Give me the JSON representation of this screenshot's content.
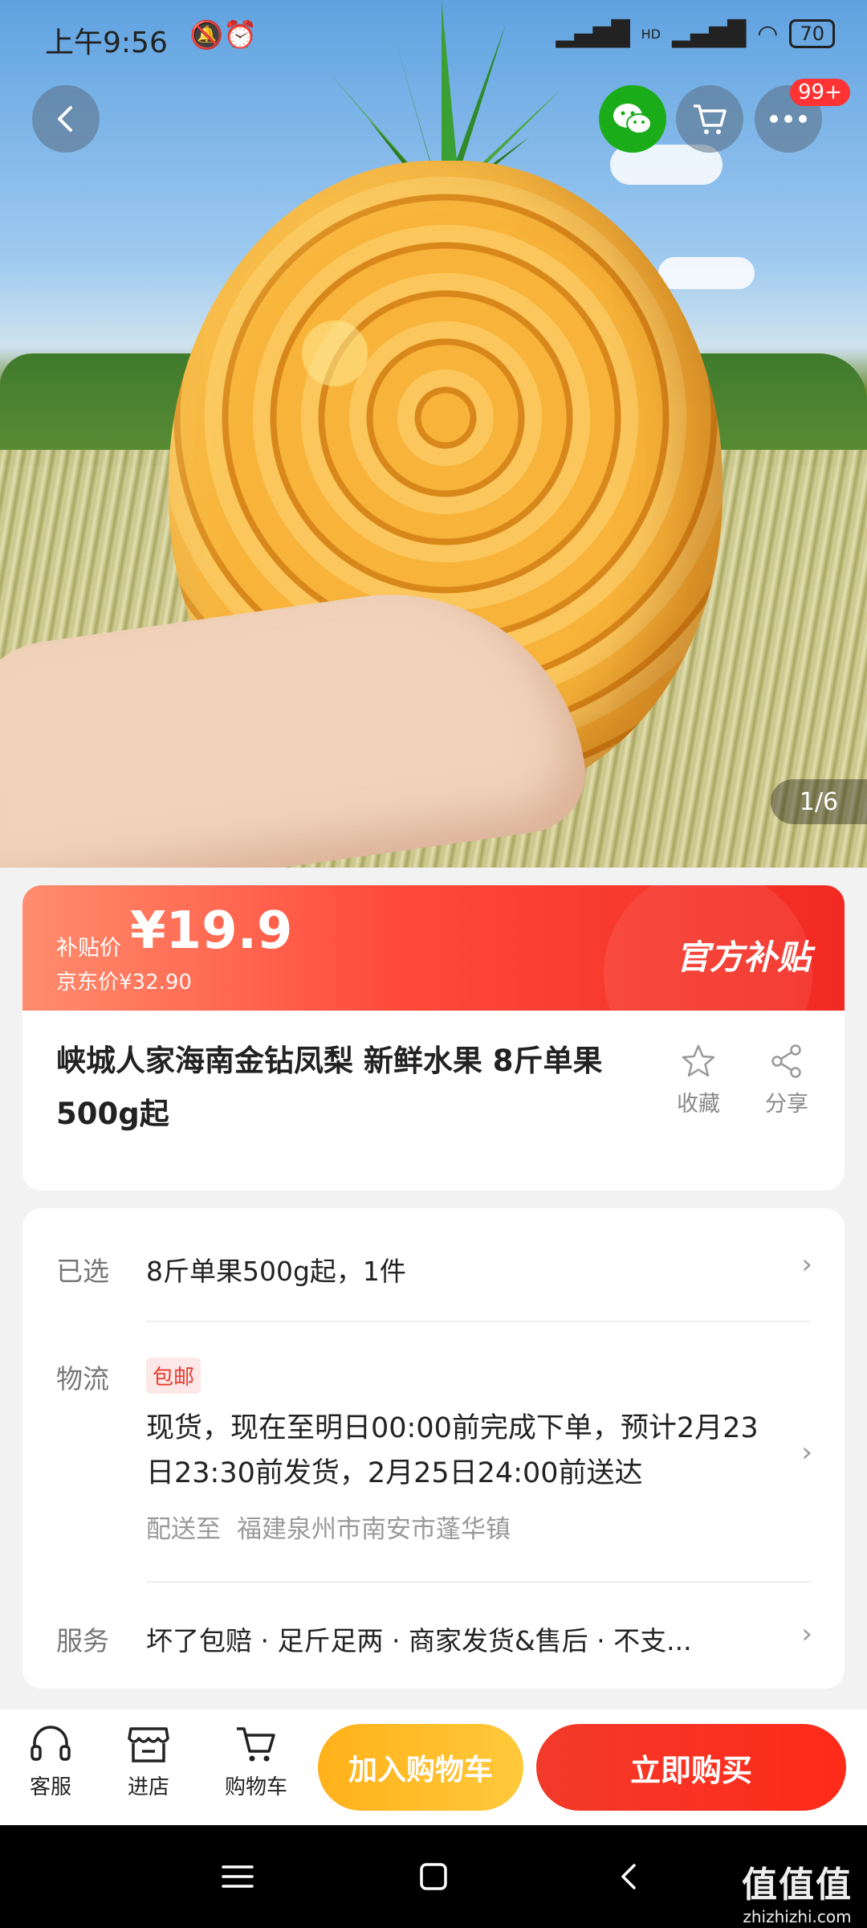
{
  "status_bar": {
    "time": "上午9:56",
    "battery": "70",
    "network": "HD"
  },
  "gallery": {
    "page_indicator": "1/6"
  },
  "top_actions": {
    "badge": "99+"
  },
  "price": {
    "label": "补贴价",
    "value": "¥19.9",
    "jd_price": "京东价¥32.90",
    "subsidy_tag": "官方补贴"
  },
  "product": {
    "title": "峡城人家海南金钻凤梨 新鲜水果 8斤单果500g起",
    "favorite_label": "收藏",
    "share_label": "分享"
  },
  "selection": {
    "label": "已选",
    "value": "8斤单果500g起，1件"
  },
  "logistics": {
    "label": "物流",
    "tag": "包邮",
    "text": "现货，现在至明日00:00前完成下单，预计2月23日23:30前发货，2月25日24:00前送达",
    "deliver_to_label": "配送至",
    "address": "福建泉州市南安市蓬华镇"
  },
  "service": {
    "label": "服务",
    "text": "坏了包赔 · 足斤足两 · 商家发货&售后 · 不支..."
  },
  "bottom_bar": {
    "customer_service": "客服",
    "shop": "进店",
    "cart": "购物车",
    "add_to_cart": "加入购物车",
    "buy_now": "立即购买"
  },
  "watermark": {
    "logo": "值值值",
    "site": "zhizhizhi.com"
  },
  "colors": {
    "accent_red": "#f12a22",
    "cart_yellow": "#ffb11a",
    "wechat_green": "#1aad19"
  }
}
